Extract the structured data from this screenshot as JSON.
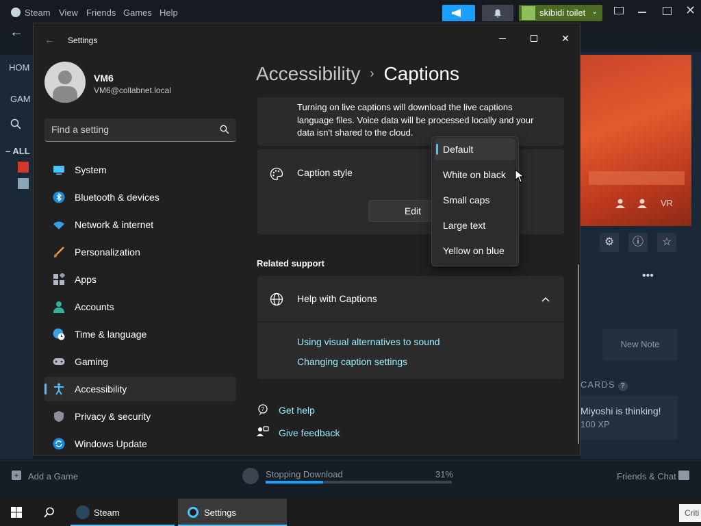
{
  "steam": {
    "menu": [
      "Steam",
      "View",
      "Friends",
      "Games",
      "Help"
    ],
    "account_name": "skibidi toilet",
    "left_labels": [
      "HOM",
      "GAM",
      "ALL"
    ],
    "hero_vr": "VR",
    "new_note": "New Note",
    "cards_title": "CARDS",
    "card_text": "Miyoshi is thinking!",
    "card_xp": "100 XP",
    "add_game": "Add a Game",
    "download_status": "Stopping Download",
    "download_percent": "31%",
    "download_progress": 0.31,
    "friends_chat": "Friends & Chat",
    "accent": "#1a9fff"
  },
  "taskbar": {
    "steam_label": "Steam",
    "settings_label": "Settings",
    "tray_text": "Criti"
  },
  "settings": {
    "title": "Settings",
    "user": {
      "name": "VM6",
      "email": "VM6@collabnet.local"
    },
    "search": {
      "placeholder": "Find a setting"
    },
    "nav": [
      {
        "label": "System",
        "icon": "monitor-icon"
      },
      {
        "label": "Bluetooth & devices",
        "icon": "bluetooth-icon"
      },
      {
        "label": "Network & internet",
        "icon": "wifi-icon"
      },
      {
        "label": "Personalization",
        "icon": "brush-icon"
      },
      {
        "label": "Apps",
        "icon": "apps-icon"
      },
      {
        "label": "Accounts",
        "icon": "person-icon"
      },
      {
        "label": "Time & language",
        "icon": "clock-globe-icon"
      },
      {
        "label": "Gaming",
        "icon": "gamepad-icon"
      },
      {
        "label": "Accessibility",
        "icon": "accessibility-icon",
        "active": true
      },
      {
        "label": "Privacy & security",
        "icon": "shield-icon"
      },
      {
        "label": "Windows Update",
        "icon": "update-icon"
      }
    ],
    "breadcrumb": {
      "parent": "Accessibility",
      "separator": "›",
      "current": "Captions"
    },
    "info_text": "Turning on live captions will download the live captions language files. Voice data will be processed locally and your data isn't shared to the cloud.",
    "caption_style": {
      "label": "Caption style",
      "edit_label": "Edit",
      "options": [
        "Default",
        "White on black",
        "Small caps",
        "Large text",
        "Yellow on blue"
      ],
      "selected": "Default"
    },
    "related_support": {
      "title": "Related support",
      "help_title": "Help with Captions",
      "links": [
        "Using visual alternatives to sound",
        "Changing caption settings"
      ]
    },
    "footer_links": {
      "get_help": "Get help",
      "give_feedback": "Give feedback"
    },
    "accent": "#4cc2ff",
    "link_color": "#99ebff"
  }
}
